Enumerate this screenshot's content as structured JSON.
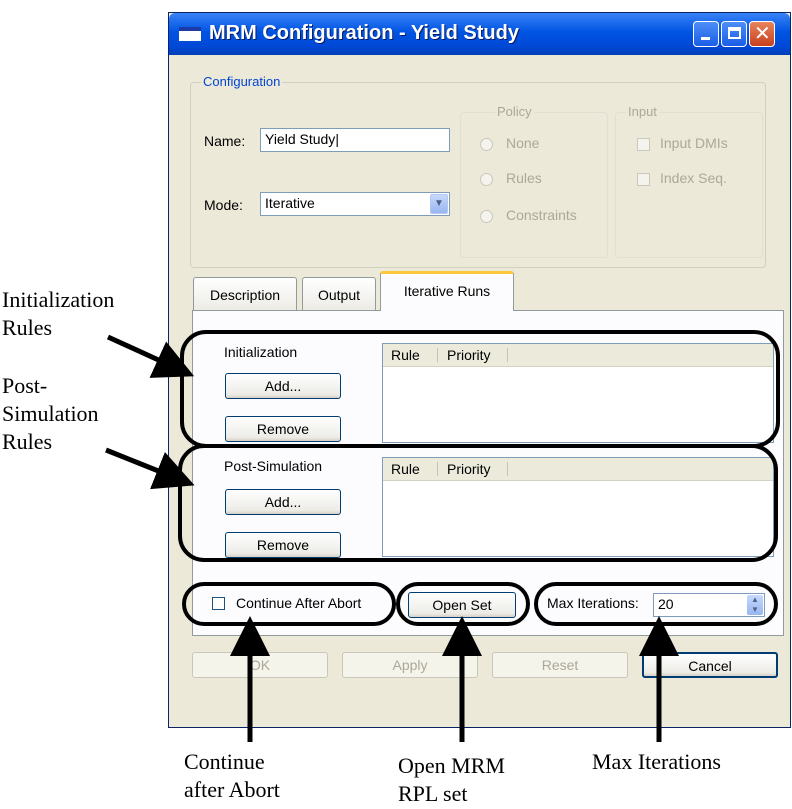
{
  "window": {
    "title": "MRM Configuration - Yield Study"
  },
  "configuration": {
    "legend": "Configuration",
    "name_label": "Name:",
    "name_value": "Yield Study",
    "mode_label": "Mode:",
    "mode_value": "Iterative"
  },
  "policy": {
    "legend": "Policy",
    "options": [
      "None",
      "Rules",
      "Constraints"
    ]
  },
  "input": {
    "legend": "Input",
    "options": [
      "Input DMIs",
      "Index Seq."
    ]
  },
  "tabs": [
    "Description",
    "Output",
    "Iterative Runs"
  ],
  "active_tab": "Iterative Runs",
  "initialization": {
    "label": "Initialization",
    "add_label": "Add...",
    "remove_label": "Remove",
    "columns": [
      "Rule",
      "Priority"
    ]
  },
  "post_simulation": {
    "label": "Post-Simulation",
    "add_label": "Add...",
    "remove_label": "Remove",
    "columns": [
      "Rule",
      "Priority"
    ]
  },
  "bottom": {
    "continue_label": "Continue After Abort",
    "open_set_label": "Open Set",
    "max_iterations_label": "Max Iterations:",
    "max_iterations_value": "20"
  },
  "footer_buttons": {
    "ok": "OK",
    "apply": "Apply",
    "reset": "Reset",
    "cancel": "Cancel"
  },
  "annotations": {
    "init_rules": [
      "Initialization",
      "Rules"
    ],
    "post_rules": [
      "Post-",
      "Simulation",
      "Rules"
    ],
    "continue": [
      "Continue",
      "after Abort"
    ],
    "open_set": [
      "Open MRM",
      "RPL set"
    ],
    "max_iter": [
      "Max Iterations"
    ]
  }
}
